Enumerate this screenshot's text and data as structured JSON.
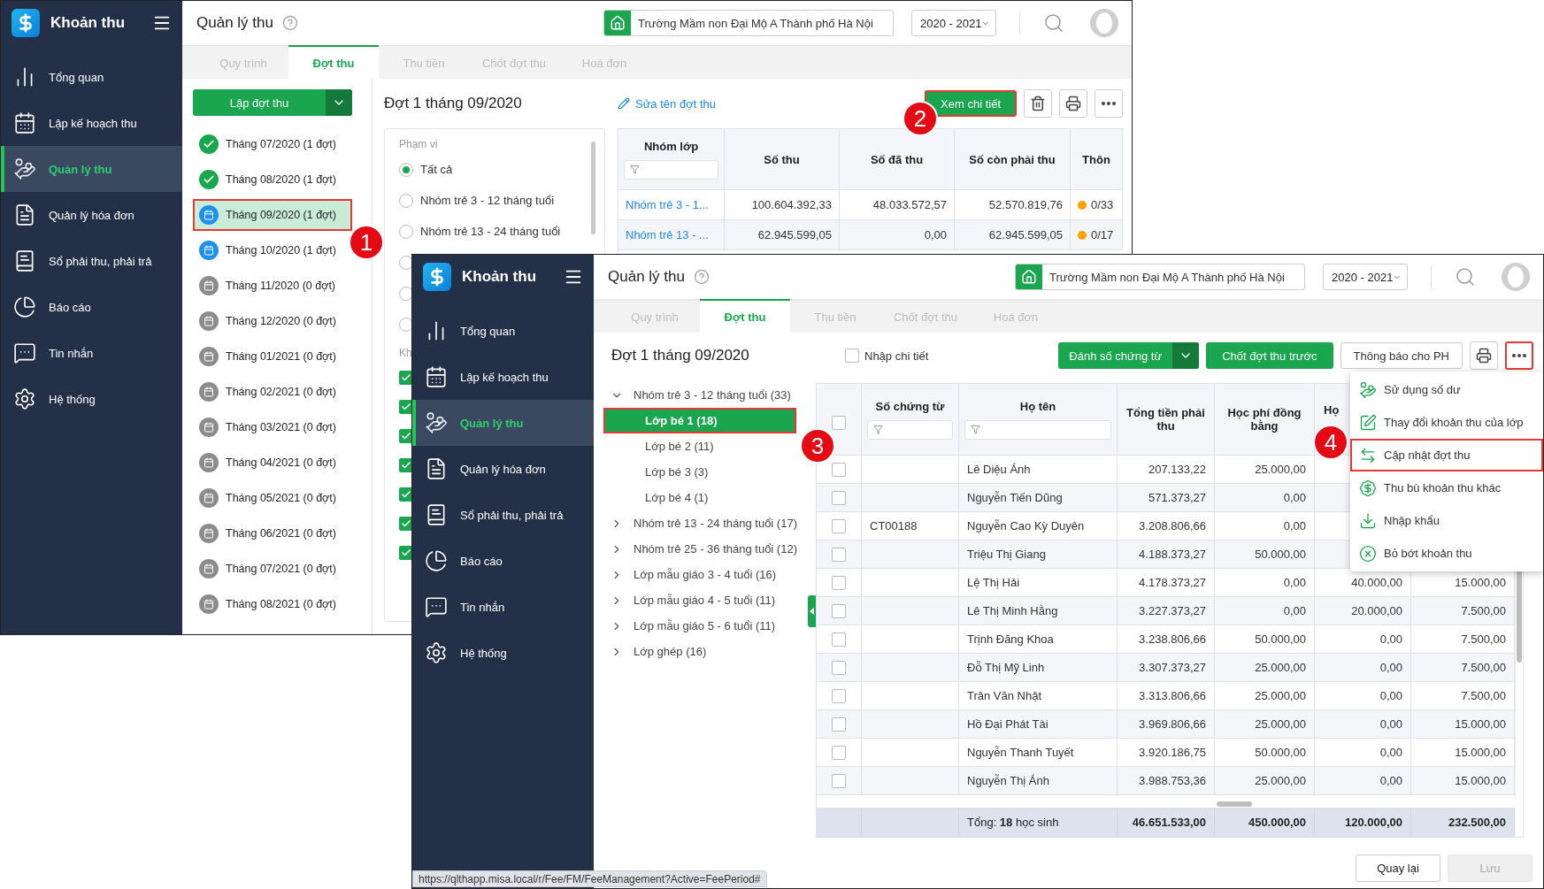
{
  "back_window": {
    "app_name": "Khoản thu",
    "page_title": "Quản lý thu",
    "school": "Trường Mầm non Đại Mộ A Thành phố Hà Nội",
    "year": "2020 - 2021",
    "nav": [
      {
        "kind": "overview",
        "label": "Tổng quan",
        "selected": false
      },
      {
        "kind": "plan",
        "label": "Lập kế hoạch thu",
        "selected": false
      },
      {
        "kind": "collect",
        "label": "Quản lý thu",
        "selected": true
      },
      {
        "kind": "invoice",
        "label": "Quản lý hóa đơn",
        "selected": false
      },
      {
        "kind": "ledger",
        "label": "Sổ phải thu, phải trả",
        "selected": false
      },
      {
        "kind": "report",
        "label": "Báo cáo",
        "selected": false
      },
      {
        "kind": "message",
        "label": "Tin nhắn",
        "selected": false
      },
      {
        "kind": "system",
        "label": "Hệ thống",
        "selected": false
      }
    ],
    "tabs": [
      {
        "label": "Quy trình",
        "selected": false
      },
      {
        "label": "Đợt thu",
        "selected": true
      },
      {
        "label": "Thu tiền",
        "selected": false
      },
      {
        "label": "Chốt đợt thu",
        "selected": false
      },
      {
        "label": "Hoá đơn",
        "selected": false
      }
    ],
    "create_button": "Lập đợt thu",
    "periods": [
      {
        "label": "Tháng 07/2020 (1 đợt)",
        "kind": "done",
        "selected": false,
        "highlighted": false
      },
      {
        "label": "Tháng 08/2020 (1 đợt)",
        "kind": "done",
        "selected": false,
        "highlighted": false
      },
      {
        "label": "Tháng 09/2020 (1 đợt)",
        "kind": "open",
        "selected": true,
        "highlighted": true
      },
      {
        "label": "Tháng 10/2020 (1 đợt)",
        "kind": "open",
        "selected": false,
        "highlighted": false
      },
      {
        "label": "Tháng 11/2020 (0 đợt)",
        "kind": "empty",
        "selected": false,
        "highlighted": false
      },
      {
        "label": "Tháng 12/2020 (0 đợt)",
        "kind": "empty",
        "selected": false,
        "highlighted": false
      },
      {
        "label": "Tháng 01/2021 (0 đợt)",
        "kind": "empty",
        "selected": false,
        "highlighted": false
      },
      {
        "label": "Tháng 02/2021 (0 đợt)",
        "kind": "empty",
        "selected": false,
        "highlighted": false
      },
      {
        "label": "Tháng 03/2021 (0 đợt)",
        "kind": "empty",
        "selected": false,
        "highlighted": false
      },
      {
        "label": "Tháng 04/2021 (0 đợt)",
        "kind": "empty",
        "selected": false,
        "highlighted": false
      },
      {
        "label": "Tháng 05/2021 (0 đợt)",
        "kind": "empty",
        "selected": false,
        "highlighted": false
      },
      {
        "label": "Tháng 06/2021 (0 đợt)",
        "kind": "empty",
        "selected": false,
        "highlighted": false
      },
      {
        "label": "Tháng 07/2021 (0 đợt)",
        "kind": "empty",
        "selected": false,
        "highlighted": false
      },
      {
        "label": "Tháng 08/2021 (0 đợt)",
        "kind": "empty",
        "selected": false,
        "highlighted": false
      }
    ],
    "period_title": "Đợt 1 tháng 09/2020",
    "rename_link": "Sửa tên đợt thu",
    "toolbar": [
      {
        "kind": "primary",
        "label": "Xem chi tiết",
        "highlighted": true
      },
      {
        "kind": "delete",
        "highlighted": false
      },
      {
        "kind": "print",
        "highlighted": false
      },
      {
        "kind": "more",
        "highlighted": false
      }
    ],
    "scope": {
      "label": "Phạm vi",
      "options": [
        {
          "label": "Tất cả",
          "selected": true
        },
        {
          "label": "Nhóm trẻ 3 - 12 tháng tuổi",
          "selected": false
        },
        {
          "label": "Nhóm trẻ 13 - 24 tháng tuổi",
          "selected": false
        },
        {
          "selected": false
        },
        {
          "selected": false
        },
        {
          "selected": false
        }
      ],
      "section_label": "Kh",
      "checks": [
        {
          "checked": true
        },
        {
          "checked": true
        },
        {
          "checked": true
        },
        {
          "checked": true
        },
        {
          "checked": true
        },
        {
          "checked": true
        },
        {
          "checked": true
        }
      ]
    },
    "table": {
      "columns": [
        "Nhóm lớp",
        "Số thu",
        "Số đã thu",
        "Số còn phải thu",
        "Thôn"
      ],
      "rows": [
        {
          "group": "Nhóm trẻ 3 - 1...",
          "amount": "100.604.392,33",
          "paid": "48.033.572,57",
          "remaining": "52.570.819,76",
          "status": "0/33",
          "color": "#ffa000"
        },
        {
          "group": "Nhóm trẻ 13 - ...",
          "amount": "62.945.599,05",
          "paid": "0,00",
          "remaining": "62.945.599,05",
          "status": "0/17",
          "color": "#ffa000"
        }
      ]
    }
  },
  "front_window": {
    "app_name": "Khoản thu",
    "page_title": "Quản lý thu",
    "school": "Trường Mầm non Đại Mộ A Thành phố Hà Nội",
    "year": "2020 - 2021",
    "nav": [
      {
        "kind": "overview",
        "label": "Tổng quan",
        "selected": false
      },
      {
        "kind": "plan",
        "label": "Lập kế hoạch thu",
        "selected": false
      },
      {
        "kind": "collect",
        "label": "Quản lý thu",
        "selected": true
      },
      {
        "kind": "invoice",
        "label": "Quản lý hóa đơn",
        "selected": false
      },
      {
        "kind": "ledger",
        "label": "Sổ phải thu, phải trả",
        "selected": false
      },
      {
        "kind": "report",
        "label": "Báo cáo",
        "selected": false
      },
      {
        "kind": "message",
        "label": "Tin nhắn",
        "selected": false
      },
      {
        "kind": "system",
        "label": "Hệ thống",
        "selected": false
      }
    ],
    "tabs": [
      {
        "label": "Quy trình",
        "selected": false
      },
      {
        "label": "Đợt thu",
        "selected": true
      },
      {
        "label": "Thu tiền",
        "selected": false
      },
      {
        "label": "Chốt đợt thu",
        "selected": false
      },
      {
        "label": "Hoá đơn",
        "selected": false
      }
    ],
    "period_title": "Đợt 1 tháng 09/2020",
    "detail_checkbox": {
      "label": "Nhập chi tiết",
      "checked": false
    },
    "toolbar": [
      {
        "kind": "split",
        "label": "Đánh số chứng từ",
        "highlighted": false
      },
      {
        "kind": "primary",
        "label": "Chốt đợt thu trước",
        "highlighted": false
      },
      {
        "kind": "outline",
        "label": "Thông báo cho PH",
        "highlighted": false
      },
      {
        "kind": "print",
        "highlighted": false
      },
      {
        "kind": "more",
        "highlighted": true
      }
    ],
    "tree": [
      {
        "label": "Nhóm trẻ 3 - 12 tháng tuổi (33)",
        "expanded": true,
        "children": [
          {
            "label": "Lớp bé 1 (18)",
            "selected": true,
            "highlighted": true
          },
          {
            "label": "Lớp bé 2 (11)",
            "selected": false,
            "highlighted": false
          },
          {
            "label": "Lớp bé 3 (3)",
            "selected": false,
            "highlighted": false
          },
          {
            "label": "Lớp bé 4 (1)",
            "selected": false,
            "highlighted": false
          }
        ]
      },
      {
        "label": "Nhóm trẻ 13 - 24 tháng tuổi (17)",
        "expanded": false
      },
      {
        "label": "Nhóm trẻ 25 - 36 tháng tuổi (12)",
        "expanded": false
      },
      {
        "label": "Lớp mẫu giáo 3 - 4 tuổi (16)",
        "expanded": false
      },
      {
        "label": "Lớp mẫu giáo 4 - 5 tuổi (11)",
        "expanded": false
      },
      {
        "label": "Lớp mẫu giáo 5 - 6 tuổi (11)",
        "expanded": false
      },
      {
        "label": "Lớp ghép (16)",
        "expanded": false
      }
    ],
    "table": {
      "header_checked": false,
      "columns": [
        "Số chứng từ",
        "Họ tên",
        "Tổng tiền phải thu",
        "Học phí đồng bằng",
        "Họ"
      ],
      "rows": [
        {
          "checked": false,
          "name": "Lê Diệu Ánh",
          "total": "207.133,22",
          "tuition": "25.000,00"
        },
        {
          "checked": false,
          "name": "Nguyễn Tiến Dũng",
          "total": "571.373,27",
          "tuition": "0,00"
        },
        {
          "checked": false,
          "doc": "CT00188",
          "name": "Nguyễn Cao Kỳ Duyên",
          "total": "3.208.806,66",
          "tuition": "0,00"
        },
        {
          "checked": false,
          "name": "Triệu Thị Giang",
          "total": "4.188.373,27",
          "tuition": "50.000,00"
        },
        {
          "checked": false,
          "name": "Lệ Thị Hải",
          "total": "4.178.373,27",
          "tuition": "0,00",
          "column_6": "40.000,00",
          "column_7": "15.000,00"
        },
        {
          "checked": false,
          "name": "Lê Thị Minh Hằng",
          "total": "3.227.373,27",
          "tuition": "0,00",
          "column_6": "20.000,00",
          "column_7": "7.500,00"
        },
        {
          "checked": false,
          "name": "Trịnh Đăng Khoa",
          "total": "3.238.806,66",
          "tuition": "50.000,00",
          "column_6": "0,00",
          "column_7": "7.500,00"
        },
        {
          "checked": false,
          "name": "Đỗ Thị Mỹ Linh",
          "total": "3.307.373,27",
          "tuition": "25.000,00",
          "column_6": "0,00",
          "column_7": "7.500,00"
        },
        {
          "checked": false,
          "name": "Trân Văn Nhật",
          "total": "3.313.806,66",
          "tuition": "25.000,00",
          "column_6": "0,00",
          "column_7": "7.500,00"
        },
        {
          "checked": false,
          "name": "Hồ Đại Phát Tài",
          "total": "3.969.806,66",
          "tuition": "25.000,00",
          "column_6": "0,00",
          "column_7": "15.000,00"
        },
        {
          "checked": false,
          "name": "Nguyễn Thanh Tuyết",
          "total": "3.920.186,75",
          "tuition": "50.000,00",
          "column_6": "0,00",
          "column_7": "15.000,00"
        },
        {
          "checked": false,
          "name": "Nguyễn Thị Ánh",
          "total": "3.988.753,36",
          "tuition": "25.000,00",
          "column_6": "0,00",
          "column_7": "15.000,00"
        }
      ],
      "footer": {
        "label": "Tổng: **18** học sinh",
        "values": [
          "46.651.533,00",
          "450.000,00",
          "120.000,00",
          "232.500,00"
        ]
      }
    },
    "menu": [
      {
        "kind": "balance",
        "label": "Sử dụng số dư",
        "highlighted": false
      },
      {
        "kind": "edit",
        "label": "Thay đổi khoản thu của lớp",
        "highlighted": false
      },
      {
        "kind": "sync",
        "label": "Cập nhật đợt thu",
        "highlighted": true
      },
      {
        "kind": "bag",
        "label": "Thu bù khoản thu khác",
        "highlighted": false
      },
      {
        "kind": "import",
        "label": "Nhập khẩu",
        "highlighted": false
      },
      {
        "kind": "remove",
        "label": "Bỏ bớt khoản thu",
        "highlighted": false
      }
    ],
    "actions": [
      {
        "label": "Quay lại",
        "disabled": false
      },
      {
        "label": "Lưu",
        "disabled": true
      }
    ],
    "status_url": "https://qlthapp.misa.local/r/Fee/FM/FeeManagement?Active=FeePeriod#"
  },
  "callouts": [
    "1",
    "2",
    "3",
    "4"
  ]
}
